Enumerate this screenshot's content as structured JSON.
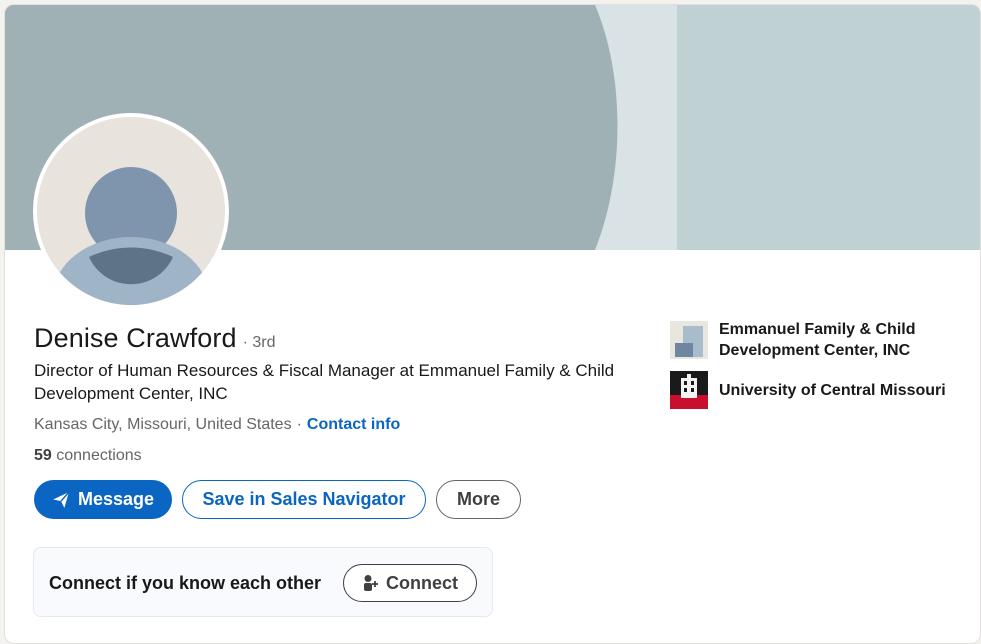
{
  "profile": {
    "name": "Denise Crawford",
    "degree": "· 3rd",
    "headline": "Director of Human Resources & Fiscal Manager at Emmanuel Family & Child Development Center, INC",
    "location": "Kansas City, Missouri, United States",
    "location_separator": "·",
    "contact_info_label": "Contact info",
    "connections_count": "59",
    "connections_label": "connections"
  },
  "actions": {
    "message_label": "Message",
    "sales_navigator_label": "Save in Sales Navigator",
    "more_label": "More"
  },
  "connect_prompt": {
    "text": "Connect if you know each other",
    "connect_label": "Connect"
  },
  "organizations": [
    {
      "name": "Emmanuel Family & Child Development Center, INC",
      "icon": "company-logo-icon"
    },
    {
      "name": "University of Central Missouri",
      "icon": "school-logo-icon"
    }
  ],
  "colors": {
    "accent": "#0a66c2",
    "banner": "#a0b1b5",
    "avatar_bg": "#e8e3dd",
    "avatar_figure": "#8097b1"
  }
}
